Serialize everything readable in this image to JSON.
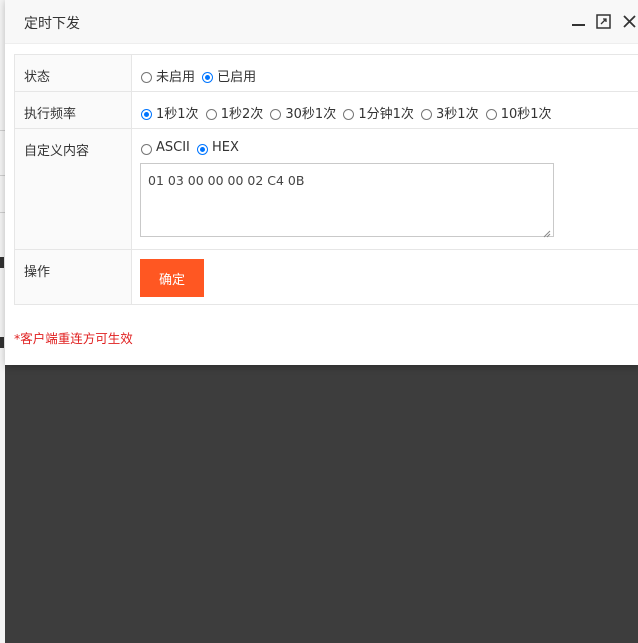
{
  "dialog": {
    "title": "定时下发",
    "min_icon": "minimize-icon",
    "max_icon": "maximize-icon",
    "close_icon": "close-icon"
  },
  "form": {
    "status": {
      "label": "状态",
      "options": [
        "未启用",
        "已启用"
      ],
      "selected": "已启用"
    },
    "frequency": {
      "label": "执行频率",
      "options": [
        "1秒1次",
        "1秒2次",
        "30秒1次",
        "1分钟1次",
        "3秒1次",
        "10秒1次"
      ],
      "selected": "1秒1次"
    },
    "custom": {
      "label": "自定义内容",
      "options": [
        "ASCII",
        "HEX"
      ],
      "selected": "HEX",
      "value": "01 03 00 00 00 02 C4 0B"
    },
    "action": {
      "label": "操作",
      "button": "确定"
    }
  },
  "note": "*客户端重连方可生效",
  "colors": {
    "accent": "#ff5722",
    "note": "#e02020",
    "radio": "#0075ff",
    "overlay": "#3d3d3d"
  }
}
